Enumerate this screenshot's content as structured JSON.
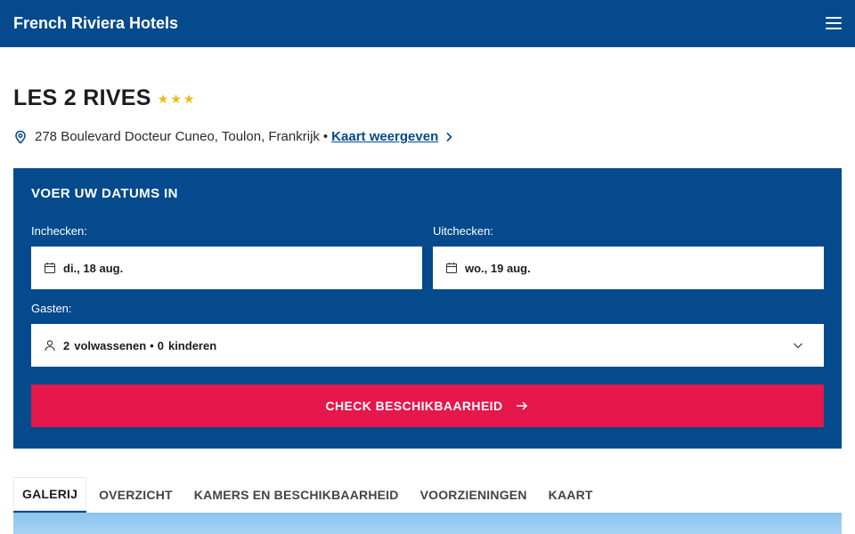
{
  "header": {
    "brand": "French Riviera Hotels",
    "menu_icon": "hamburger-icon"
  },
  "hotel": {
    "name": "LES 2 RIVES",
    "stars": 3,
    "address": "278 Boulevard Docteur Cuneo, Toulon, Frankrijk",
    "separator": "•",
    "map_link": "Kaart weergeven"
  },
  "booking": {
    "title": "VOER UW DATUMS IN",
    "checkin_label": "Inchecken:",
    "checkin_value": "di., 18 aug.",
    "checkout_label": "Uitchecken:",
    "checkout_value": "wo., 19 aug.",
    "guests_label": "Gasten:",
    "adults_count": "2",
    "adults_label": "volwassenen",
    "children_count": "0",
    "children_label": "kinderen",
    "guest_separator": "•",
    "cta": "CHECK BESCHIKBAARHEID"
  },
  "tabs": [
    "GALERIJ",
    "OVERZICHT",
    "KAMERS EN BESCHIKBAARHEID",
    "VOORZIENINGEN",
    "KAART"
  ],
  "active_tab": "GALERIJ",
  "colors": {
    "primary": "#044a8c",
    "cta": "#e5174b",
    "star": "#f2b90d"
  }
}
